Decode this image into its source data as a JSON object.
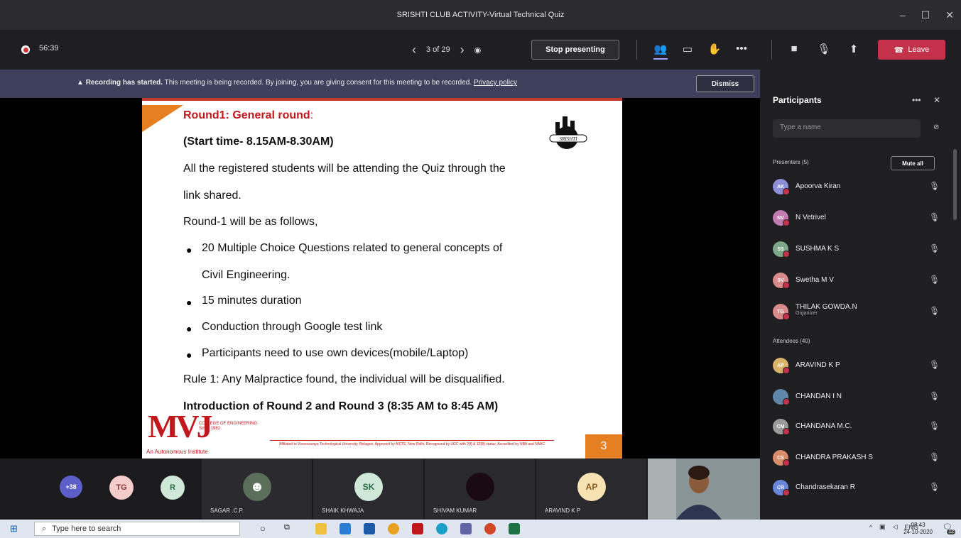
{
  "window": {
    "title": "SRISHTI CLUB ACTIVITY-Virtual Technical Quiz",
    "controls": [
      "–",
      "☐",
      "✕"
    ]
  },
  "toolbar": {
    "timer": "56:39",
    "page_indicator": "3 of 29",
    "prev_arrow": "‹",
    "next_arrow": "›",
    "stop_presenting": "Stop presenting",
    "leave": "Leave",
    "accent": "#c4314b"
  },
  "banner": {
    "bold": "Recording has started.",
    "text": "This meeting is being recorded. By joining, you are giving consent for this meeting to be recorded.",
    "link": "Privacy policy",
    "dismiss": "Dismiss"
  },
  "slide": {
    "heading": "Round1: General round",
    "heading_colon": ":",
    "start_time": "(Start time- 8.15AM-8.30AM)",
    "line1": "All the registered students will be attending the Quiz through the",
    "line2": "link shared.",
    "line3": "Round-1 will be as follows,",
    "bullets": [
      "20 Multiple Choice Questions related to general concepts of",
      "Civil Engineering.",
      "15 minutes duration",
      "Conduction through Google test link",
      "Participants need to use own devices(mobile/Laptop)"
    ],
    "rule": "Rule 1: Any Malpractice found, the individual will be disqualified.",
    "intro": "Introduction of Round 2 and Round 3 (8:35 AM to 8:45 AM)",
    "logo_text": "SRISHTI",
    "college_logo": "MVJ",
    "college_sub": "COLLEGE OF ENGINEERING",
    "college_since": "Since 1982",
    "college_tag": "An Autonomous Institute",
    "affiliation": "Affiliated to Visvesvaraya Technological University, Belagavi, Approved by AICTE, New Delhi, Recognized by UGC with 2(f) & 12(B) status, Accredited by NBA and NAAC",
    "page_number": "3"
  },
  "gallery": {
    "overflow": "+38",
    "avatars": [
      {
        "initials": "TG",
        "color": "#f4cccc"
      },
      {
        "initials": "R",
        "color": "#cfe8d8"
      }
    ],
    "tiles": [
      {
        "name": "SAGAR .C.P.",
        "initials": "",
        "color": "#5a6e5a"
      },
      {
        "name": "SHAIK KHWAJA",
        "initials": "SK",
        "color": "#cfe8d8"
      },
      {
        "name": "SHIVAM KUMAR",
        "initials": "",
        "color": "#1a0a12"
      },
      {
        "name": "ARAVIND K P",
        "initials": "AP",
        "color": "#f6e2b3"
      }
    ]
  },
  "panel": {
    "title": "Participants",
    "more": "•••",
    "close": "✕",
    "search_placeholder": "Type a name",
    "presenters_label": "Presenters (5)",
    "mute_all": "Mute all",
    "attendees_label": "Attendees (40)",
    "presenters": [
      {
        "initials": "AK",
        "name": "Apoorva Kiran",
        "role": "",
        "color": "#8e8fd8"
      },
      {
        "initials": "NV",
        "name": "N Vetrivel",
        "role": "",
        "color": "#c27bb0"
      },
      {
        "initials": "SS",
        "name": "SUSHMA K S",
        "role": "",
        "color": "#7fa88a"
      },
      {
        "initials": "SV",
        "name": "Swetha M V",
        "role": "",
        "color": "#d98b8b"
      },
      {
        "initials": "TG",
        "name": "THILAK GOWDA.N",
        "role": "Organizer",
        "color": "#d98b8b"
      }
    ],
    "attendees": [
      {
        "initials": "AP",
        "name": "ARAVIND K P",
        "color": "#d9b36a"
      },
      {
        "initials": "",
        "name": "CHANDAN I N",
        "color": "#5f86a8"
      },
      {
        "initials": "CM",
        "name": "CHANDANA M.C.",
        "color": "#9a9a9a"
      },
      {
        "initials": "CS",
        "name": "CHANDRA PRAKASH S",
        "color": "#d98b6a"
      },
      {
        "initials": "CR",
        "name": "Chandrasekaran R",
        "color": "#6a86d9"
      }
    ]
  },
  "taskbar": {
    "search_placeholder": "Type here to search",
    "lang": "ENG",
    "time": "08:43",
    "date": "24-10-2020",
    "notifications": "12"
  }
}
